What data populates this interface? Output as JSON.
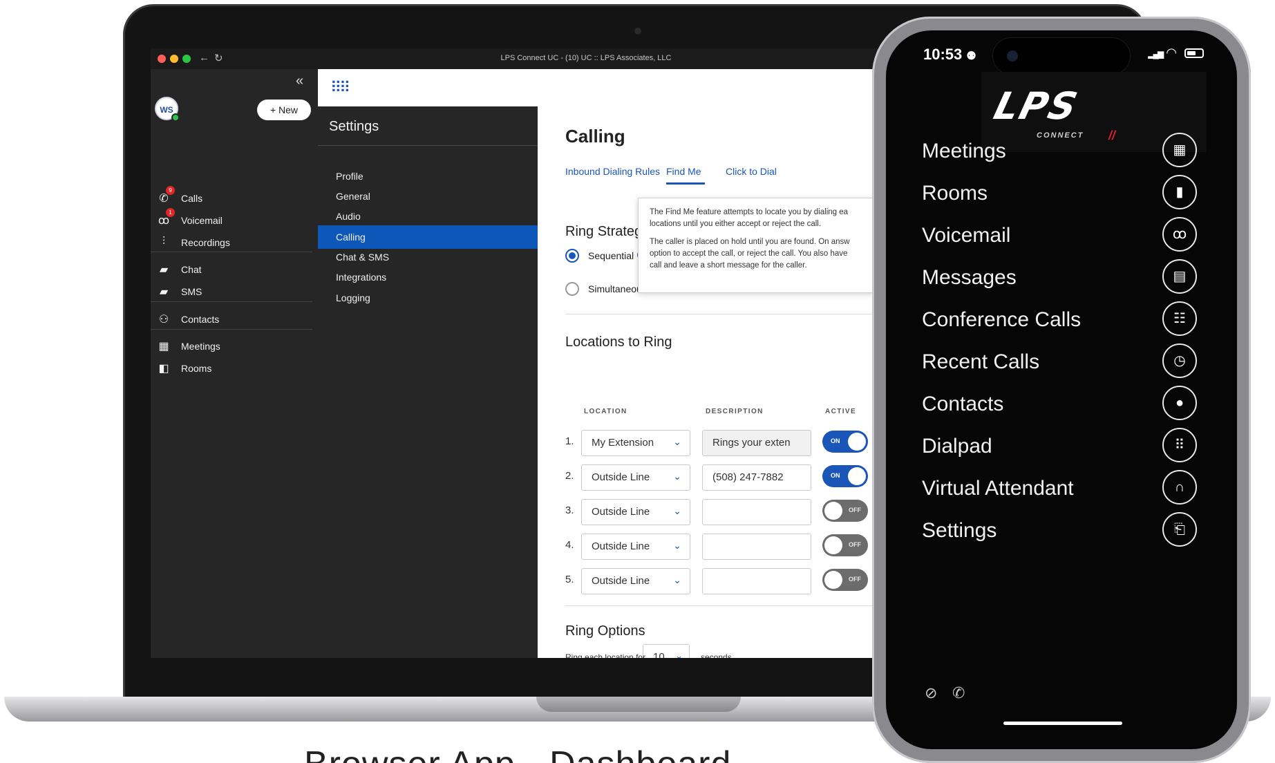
{
  "browser": {
    "title": "LPS Connect UC - (10) UC :: LPS Associates, LLC",
    "back_glyph": "←",
    "reload_glyph": "↻"
  },
  "leftnav": {
    "collapse_glyph": "«",
    "avatar_initials": "WS",
    "new_button": "+ New",
    "items": [
      {
        "label": "Calls",
        "icon": "phone-icon",
        "glyph": "✆",
        "badge": "9"
      },
      {
        "label": "Voicemail",
        "icon": "voicemail-icon",
        "glyph": "ꝏ",
        "badge": "1"
      },
      {
        "label": "Recordings",
        "icon": "waveform-icon",
        "glyph": "⫶"
      },
      {
        "label": "Chat",
        "icon": "chat-icon",
        "glyph": "▰"
      },
      {
        "label": "SMS",
        "icon": "sms-icon",
        "glyph": "▰"
      },
      {
        "label": "Contacts",
        "icon": "contacts-icon",
        "glyph": "⚇"
      },
      {
        "label": "Meetings",
        "icon": "calendar-icon",
        "glyph": "▦"
      },
      {
        "label": "Rooms",
        "icon": "door-icon",
        "glyph": "◧"
      }
    ]
  },
  "topbar": {
    "dialpad_glyph": "⠿⠿"
  },
  "settings": {
    "title": "Settings",
    "items": [
      "Profile",
      "General",
      "Audio",
      "Calling",
      "Chat & SMS",
      "Integrations",
      "Logging"
    ],
    "active": "Calling"
  },
  "content": {
    "heading": "Calling",
    "tabs": [
      "Inbound Dialing Rules",
      "Find Me",
      "Click to Dial"
    ],
    "active_tab": "Find Me",
    "ring_strategy": {
      "title": "Ring Strategy",
      "options": [
        "Sequential",
        "Simultaneous"
      ],
      "selected": "Sequential",
      "info_glyph": "i"
    },
    "tooltip": {
      "p1_line1": "The Find Me feature attempts to locate you by dialing ea",
      "p1_line2": "locations until you either accept or reject the call.",
      "p2_line1": "The caller is placed on hold until you are found. On answ",
      "p2_line2": "option to accept the call, or reject the call. You also have",
      "p2_line3": "call and leave a short message for the caller."
    },
    "locations": {
      "title": "Locations to Ring",
      "col_location": "LOCATION",
      "col_description": "DESCRIPTION",
      "col_active": "ACTIVE",
      "rows": [
        {
          "num": "1.",
          "location": "My Extension",
          "description": "Rings your exten",
          "active": "ON"
        },
        {
          "num": "2.",
          "location": "Outside Line",
          "description": "(508) 247-7882",
          "active": "ON"
        },
        {
          "num": "3.",
          "location": "Outside Line",
          "description": "",
          "active": "OFF"
        },
        {
          "num": "4.",
          "location": "Outside Line",
          "description": "",
          "active": "OFF"
        },
        {
          "num": "5.",
          "location": "Outside Line",
          "description": "",
          "active": "OFF"
        }
      ],
      "chevron_glyph": "⌄"
    },
    "ring_options": {
      "title": "Ring Options",
      "label": "Ring each location for",
      "value": "10",
      "unit": "seconds."
    }
  },
  "caption": "Browser App - Dashboard",
  "phone": {
    "time": "10:53",
    "person_glyph": "⚉",
    "signal_glyph": "▂▄▆",
    "wifi_glyph": "◠",
    "logo": "LPS",
    "logo_sub": "CONNECT",
    "logo_mark": "//",
    "menu": [
      {
        "label": "Meetings",
        "icon": "calendar-icon",
        "glyph": "▦"
      },
      {
        "label": "Rooms",
        "icon": "door-icon",
        "glyph": "▮"
      },
      {
        "label": "Voicemail",
        "icon": "voicemail-icon",
        "glyph": "ꝏ"
      },
      {
        "label": "Messages",
        "icon": "messages-icon",
        "glyph": "▤"
      },
      {
        "label": "Conference Calls",
        "icon": "group-icon",
        "glyph": "☷"
      },
      {
        "label": "Recent Calls",
        "icon": "clock-icon",
        "glyph": "◷"
      },
      {
        "label": "Contacts",
        "icon": "person-icon",
        "glyph": "●"
      },
      {
        "label": "Dialpad",
        "icon": "dialpad-icon",
        "glyph": "⠿"
      },
      {
        "label": "Virtual Attendant",
        "icon": "headset-icon",
        "glyph": "∩"
      },
      {
        "label": "Settings",
        "icon": "settings-icon",
        "glyph": "⎗"
      }
    ],
    "bottom_icons": [
      {
        "name": "do-not-disturb-icon",
        "glyph": "⊘"
      },
      {
        "name": "call-forward-icon",
        "glyph": "✆"
      }
    ]
  },
  "colors": {
    "accent": "#1a56b8",
    "active_nav": "#0d57b8",
    "badge": "#e02727",
    "status_online": "#2ec24a",
    "logo_red": "#d6202c"
  }
}
